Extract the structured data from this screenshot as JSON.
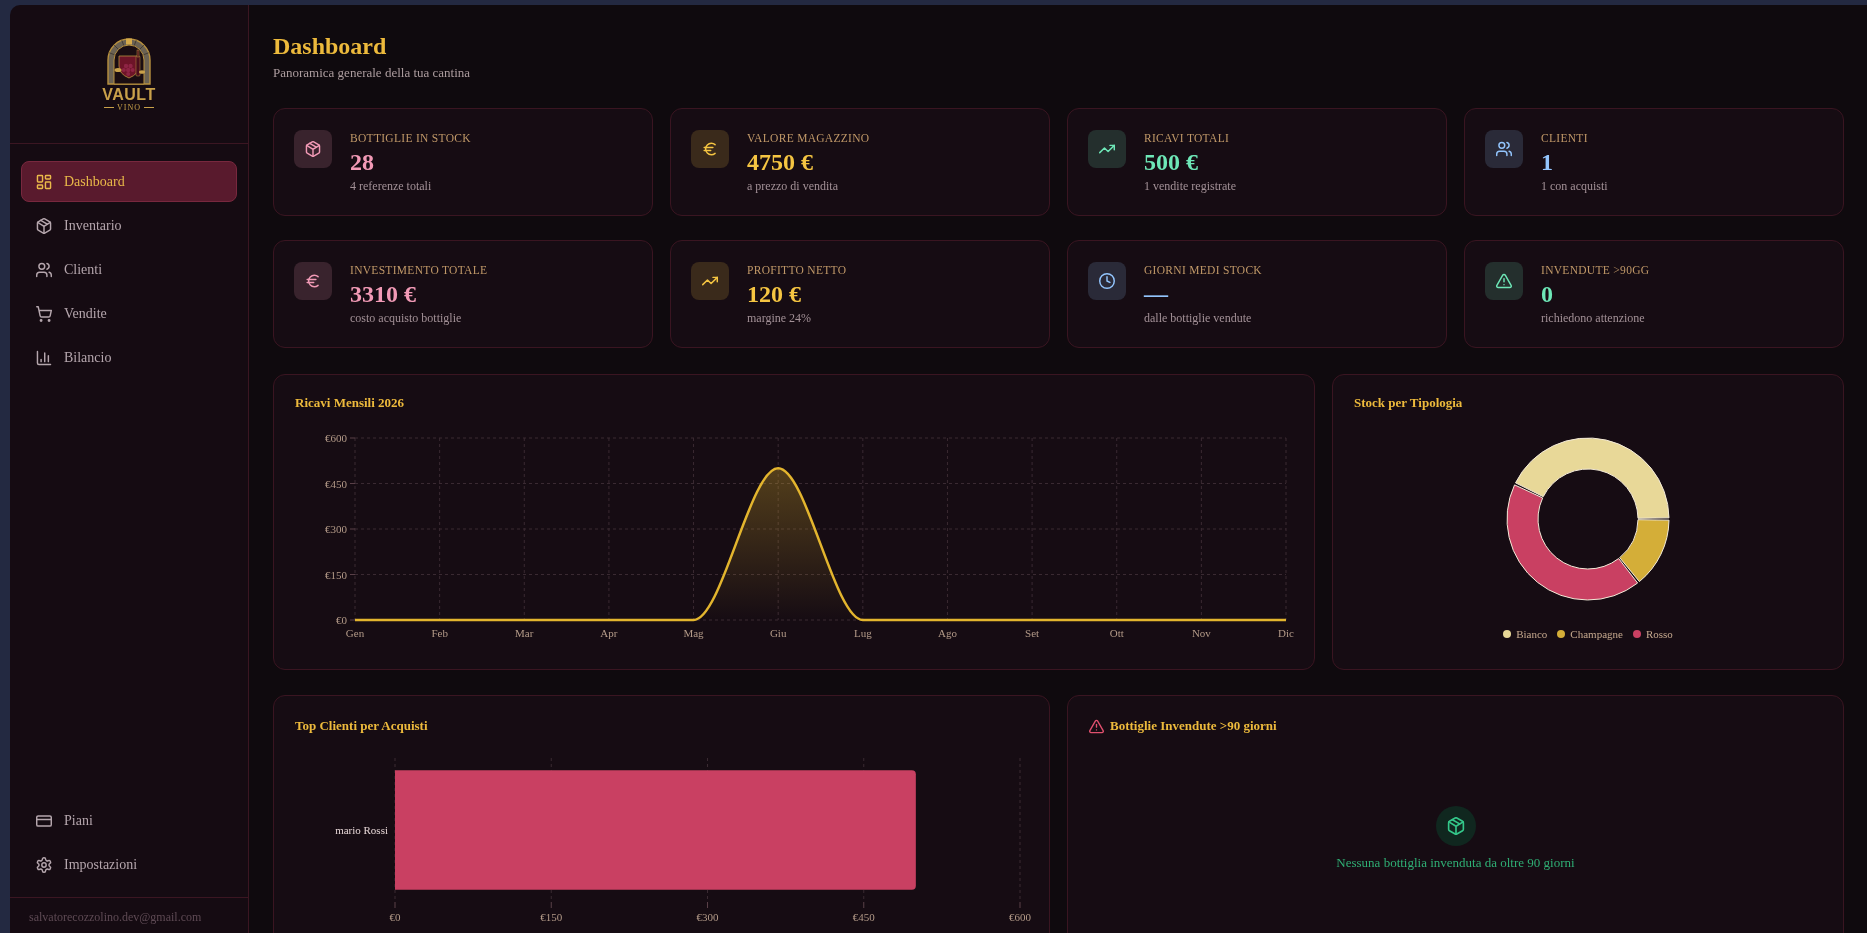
{
  "logo": {
    "title": "VAULT",
    "subtitle": "VINO"
  },
  "sidebar": {
    "items": [
      {
        "label": "Dashboard",
        "selected": true
      },
      {
        "label": "Inventario",
        "selected": false
      },
      {
        "label": "Clienti",
        "selected": false
      },
      {
        "label": "Vendite",
        "selected": false
      },
      {
        "label": "Bilancio",
        "selected": false
      }
    ],
    "footer_items": [
      {
        "label": "Piani",
        "selected": false
      },
      {
        "label": "Impostazioni",
        "selected": false
      }
    ],
    "user_email": "salvatorecozzolino.dev@gmail.com"
  },
  "header": {
    "title": "Dashboard",
    "subtitle": "Panoramica generale della tua cantina"
  },
  "stats": [
    {
      "label": "BOTTIGLIE IN STOCK",
      "value": "28",
      "note": "4 referenze totali",
      "color": "#f29ab6"
    },
    {
      "label": "VALORE MAGAZZINO",
      "value": "4750 €",
      "note": "a prezzo di vendita",
      "color": "#f5c542"
    },
    {
      "label": "RICAVI TOTALI",
      "value": "500 €",
      "note": "1 vendite registrate",
      "color": "#6ee7b7"
    },
    {
      "label": "CLIENTI",
      "value": "1",
      "note": "1 con acquisti",
      "color": "#93c5fd"
    },
    {
      "label": "INVESTIMENTO TOTALE",
      "value": "3310 €",
      "note": "costo acquisto bottiglie",
      "color": "#f29ab6"
    },
    {
      "label": "PROFITTO NETTO",
      "value": "120 €",
      "note": "margine 24%",
      "color": "#f5c542"
    },
    {
      "label": "GIORNI MEDI STOCK",
      "value": "—",
      "note": "dalle bottiglie vendute",
      "color": "#93c5fd"
    },
    {
      "label": "INVENDUTE >90GG",
      "value": "0",
      "note": "richiedono attenzione",
      "color": "#6ee7b7"
    }
  ],
  "revenue_chart": {
    "title": "Ricavi Mensili 2026",
    "chart_data": {
      "type": "area",
      "categories": [
        "Gen",
        "Feb",
        "Mar",
        "Apr",
        "Mag",
        "Giu",
        "Lug",
        "Ago",
        "Set",
        "Ott",
        "Nov",
        "Dic"
      ],
      "values": [
        0,
        0,
        0,
        0,
        0,
        500,
        0,
        0,
        0,
        0,
        0,
        0
      ],
      "ylim": [
        0,
        600
      ],
      "yticks": [
        {
          "value": 0,
          "label": "€0"
        },
        {
          "value": 150,
          "label": "€150"
        },
        {
          "value": 300,
          "label": "€300"
        },
        {
          "value": 450,
          "label": "€450"
        },
        {
          "value": 600,
          "label": "€600"
        }
      ],
      "grid": true
    }
  },
  "stock_chart": {
    "title": "Stock per Tipologia",
    "legend": [
      {
        "label": "Bianco",
        "color": "#e8d898"
      },
      {
        "label": "Champagne",
        "color": "#d4ae38"
      },
      {
        "label": "Rosso",
        "color": "#c94062"
      }
    ]
  },
  "top_clients": {
    "title": "Top Clienti per Acquisti",
    "chart_data": {
      "type": "bar",
      "orientation": "horizontal",
      "categories": [
        "mario Rossi"
      ],
      "values": [
        500
      ],
      "xlim": [
        0,
        600
      ],
      "xticks": [
        {
          "value": 0,
          "label": "€0"
        },
        {
          "value": 150,
          "label": "€150"
        },
        {
          "value": 300,
          "label": "€300"
        },
        {
          "value": 450,
          "label": "€450"
        },
        {
          "value": 600,
          "label": "€600"
        }
      ],
      "grid": true
    }
  },
  "unsold": {
    "title": "Bottiglie Invendute >90 giorni",
    "empty_message": "Nessuna bottiglia invenduta da oltre 90 giorni"
  }
}
